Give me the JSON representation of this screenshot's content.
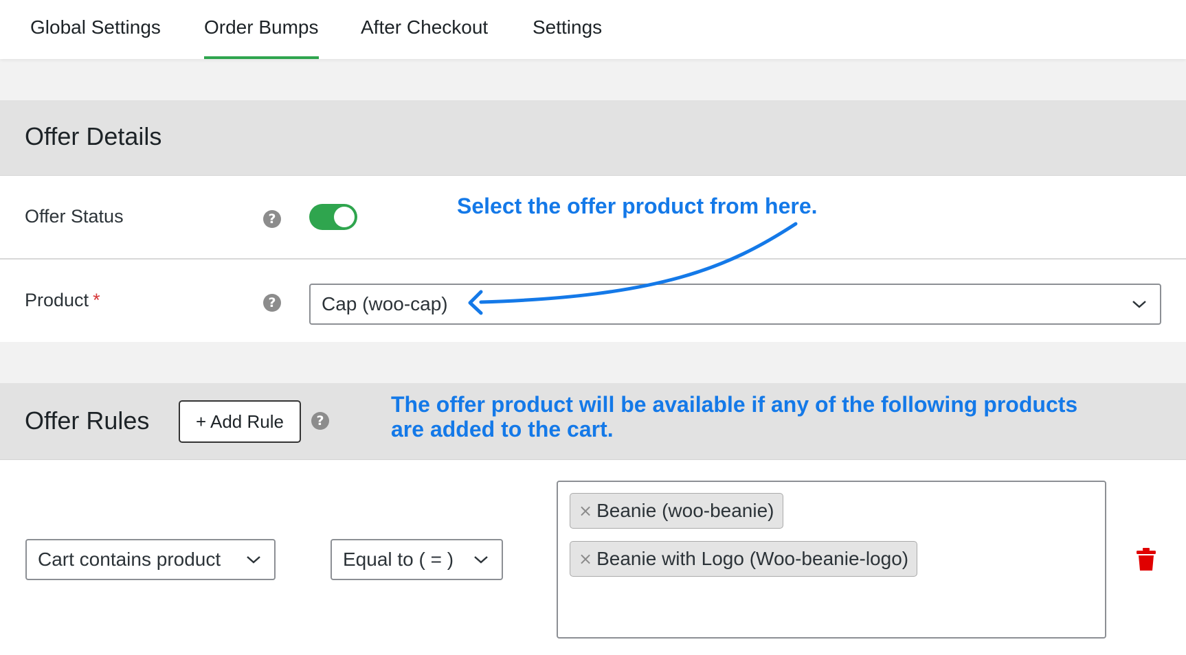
{
  "tabs": [
    {
      "label": "Global Settings",
      "active": false
    },
    {
      "label": "Order Bumps",
      "active": true
    },
    {
      "label": "After Checkout",
      "active": false
    },
    {
      "label": "Settings",
      "active": false
    }
  ],
  "offer_details": {
    "title": "Offer Details",
    "offer_status_label": "Offer Status",
    "offer_status_enabled": true,
    "product_label": "Product",
    "product_required_mark": "*",
    "product_value": "Cap (woo-cap)",
    "help_icon": "?"
  },
  "offer_rules": {
    "title": "Offer Rules",
    "add_rule_label": "+ Add Rule",
    "help_icon": "?",
    "rule": {
      "condition": "Cart contains product",
      "operator": "Equal to ( = )",
      "products": [
        "Beanie (woo-beanie)",
        "Beanie with Logo (Woo-beanie-logo)"
      ],
      "remove_x": "×"
    }
  },
  "annotations": {
    "select_product": "Select the offer product from here.",
    "rules_note_line1": "The offer product will be available if any of the following products",
    "rules_note_line2": "are added to the cart."
  },
  "colors": {
    "accent_green": "#2fa54e",
    "annotation_blue": "#1479e8",
    "trash_red": "#e00000"
  }
}
